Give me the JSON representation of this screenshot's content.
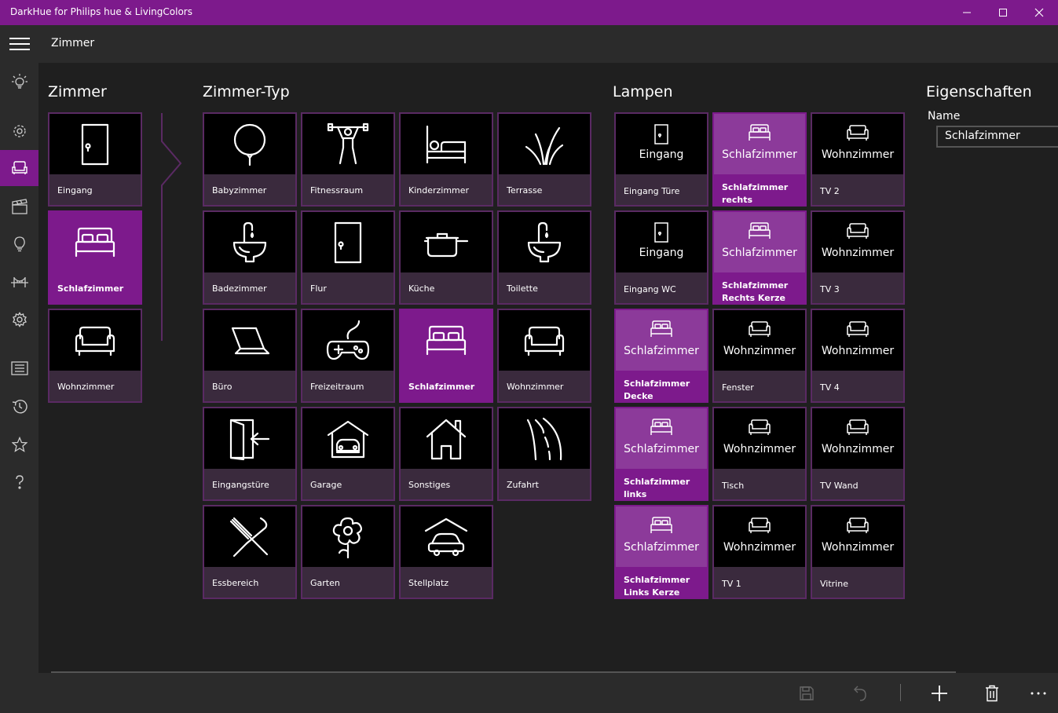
{
  "window": {
    "title": "DarkHue for Philips hue & LivingColors",
    "minimize_icon": "minimize-icon",
    "maximize_icon": "maximize-icon",
    "close_icon": "close-icon"
  },
  "header": {
    "page_title": "Zimmer"
  },
  "sidebar": {
    "items": [
      {
        "icon": "bulb-glow-icon",
        "active": false
      },
      {
        "icon": "gear-outline-icon",
        "active": false
      },
      {
        "icon": "sofa-icon",
        "active": true
      },
      {
        "icon": "clapper-icon",
        "active": false
      },
      {
        "icon": "lightbulb-icon",
        "active": false
      },
      {
        "icon": "bridge-icon",
        "active": false
      },
      {
        "icon": "settings-icon",
        "active": false
      },
      {
        "icon": "list-icon",
        "active": false
      },
      {
        "icon": "history-icon",
        "active": false
      },
      {
        "icon": "star-icon",
        "active": false
      },
      {
        "icon": "help-icon",
        "active": false
      }
    ]
  },
  "sections": {
    "zimmer": "Zimmer",
    "zimmer_typ": "Zimmer-Typ",
    "lampen": "Lampen",
    "eigenschaften": "Eigenschaften"
  },
  "zimmer": [
    {
      "label": "Eingang",
      "icon": "door-icon",
      "selected": false
    },
    {
      "label": "Schlafzimmer",
      "icon": "bed-icon",
      "selected": true
    },
    {
      "label": "Wohnzimmer",
      "icon": "sofa-icon",
      "selected": false
    }
  ],
  "zimmer_typ": [
    {
      "label": "Babyzimmer",
      "icon": "balloon-icon",
      "selected": false
    },
    {
      "label": "Fitnessraum",
      "icon": "weightlifter-icon",
      "selected": false
    },
    {
      "label": "Kinderzimmer",
      "icon": "kids-bed-icon",
      "selected": false
    },
    {
      "label": "Terrasse",
      "icon": "grass-icon",
      "selected": false
    },
    {
      "label": "Badezimmer",
      "icon": "sink-icon",
      "selected": false
    },
    {
      "label": "Flur",
      "icon": "door-icon",
      "selected": false
    },
    {
      "label": "Küche",
      "icon": "pot-icon",
      "selected": false
    },
    {
      "label": "Toilette",
      "icon": "sink-icon",
      "selected": false
    },
    {
      "label": "Büro",
      "icon": "laptop-icon",
      "selected": false
    },
    {
      "label": "Freizeitraum",
      "icon": "gamepad-icon",
      "selected": false
    },
    {
      "label": "Schlafzimmer",
      "icon": "bed-icon",
      "selected": true
    },
    {
      "label": "Wohnzimmer",
      "icon": "sofa-icon",
      "selected": false
    },
    {
      "label": "Eingangstüre",
      "icon": "enter-door-icon",
      "selected": false
    },
    {
      "label": "Garage",
      "icon": "garage-icon",
      "selected": false
    },
    {
      "label": "Sonstiges",
      "icon": "house-icon",
      "selected": false
    },
    {
      "label": "Zufahrt",
      "icon": "road-icon",
      "selected": false
    },
    {
      "label": "Essbereich",
      "icon": "cutlery-icon",
      "selected": false
    },
    {
      "label": "Garten",
      "icon": "flower-icon",
      "selected": false
    },
    {
      "label": "Stellplatz",
      "icon": "carport-icon",
      "selected": false
    }
  ],
  "lampen": [
    {
      "room": "Eingang",
      "label": "Eingang Türe",
      "icon": "door-icon",
      "selected": false
    },
    {
      "room": "Schlafzimmer",
      "label": "Schlafzimmer rechts",
      "icon": "bed-icon",
      "selected": true
    },
    {
      "room": "Wohnzimmer",
      "label": "TV 2",
      "icon": "sofa-icon",
      "selected": false
    },
    {
      "room": "Eingang",
      "label": "Eingang WC",
      "icon": "door-icon",
      "selected": false
    },
    {
      "room": "Schlafzimmer",
      "label": "Schlafzimmer Rechts Kerze",
      "icon": "bed-icon",
      "selected": true
    },
    {
      "room": "Wohnzimmer",
      "label": "TV 3",
      "icon": "sofa-icon",
      "selected": false
    },
    {
      "room": "Schlafzimmer",
      "label": "Schlafzimmer Decke",
      "icon": "bed-icon",
      "selected": true
    },
    {
      "room": "Wohnzimmer",
      "label": "Fenster",
      "icon": "sofa-icon",
      "selected": false
    },
    {
      "room": "Wohnzimmer",
      "label": "TV 4",
      "icon": "sofa-icon",
      "selected": false
    },
    {
      "room": "Schlafzimmer",
      "label": "Schlafzimmer links",
      "icon": "bed-icon",
      "selected": true
    },
    {
      "room": "Wohnzimmer",
      "label": "Tisch",
      "icon": "sofa-icon",
      "selected": false
    },
    {
      "room": "Wohnzimmer",
      "label": "TV Wand",
      "icon": "sofa-icon",
      "selected": false
    },
    {
      "room": "Schlafzimmer",
      "label": "Schlafzimmer Links Kerze",
      "icon": "bed-icon",
      "selected": true
    },
    {
      "room": "Wohnzimmer",
      "label": "TV 1",
      "icon": "sofa-icon",
      "selected": false
    },
    {
      "room": "Wohnzimmer",
      "label": "Vitrine",
      "icon": "sofa-icon",
      "selected": false
    }
  ],
  "properties": {
    "name_label": "Name",
    "name_value": "Schlafzimmer"
  },
  "commandbar": {
    "save_icon": "save-icon",
    "undo_icon": "undo-icon",
    "add_icon": "add-icon",
    "delete_icon": "delete-icon",
    "more_icon": "more-icon"
  },
  "colors": {
    "accent": "#7d1a8c",
    "tile_label_bg": "#3a2a3d",
    "background": "#1f1f1f",
    "chrome": "#2b2b2b"
  }
}
